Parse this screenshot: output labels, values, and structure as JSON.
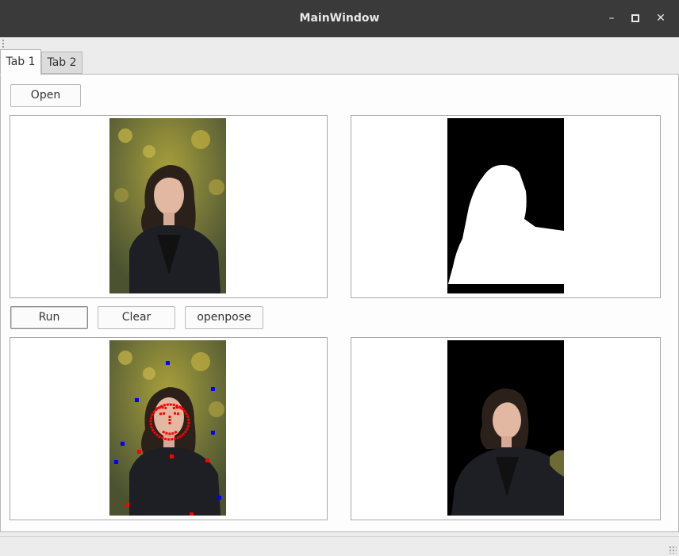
{
  "window": {
    "title": "MainWindow",
    "minimize_glyph": "–",
    "maximize_glyph": "▫",
    "close_glyph": "✕"
  },
  "tabs": [
    {
      "label": "Tab 1",
      "active": true
    },
    {
      "label": "Tab 2",
      "active": false
    }
  ],
  "buttons": {
    "open": "Open",
    "run": "Run",
    "clear": "Clear",
    "openpose": "openpose"
  },
  "colors": {
    "keypoint_red": "#ff0000",
    "keypoint_blue": "#0000ff",
    "mask_black": "#000000",
    "mask_white": "#ffffff",
    "titlebar": "#3a3a3a"
  },
  "images": {
    "original": "photo-of-woman-in-leather-jacket",
    "mask": "binary-segmentation-mask",
    "openpose": "photo-with-pose-keypoints",
    "segmented": "person-cutout-on-black"
  }
}
